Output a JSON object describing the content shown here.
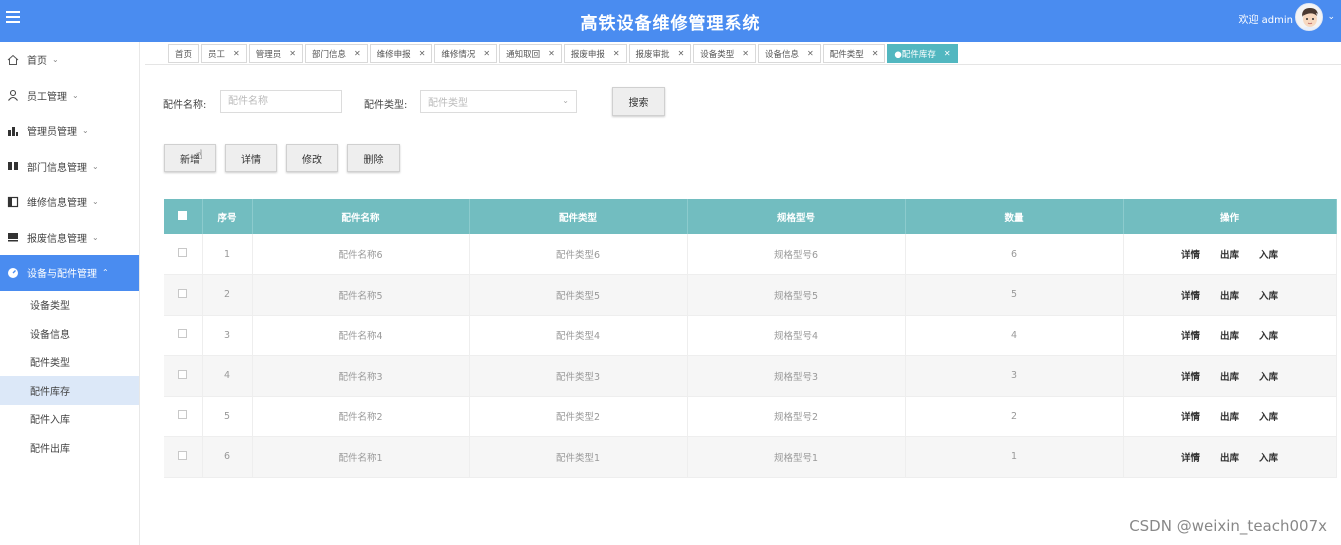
{
  "header": {
    "title": "高铁设备维修管理系统",
    "welcome": "欢迎 admin"
  },
  "sidebar": {
    "items": [
      {
        "label": "首页"
      },
      {
        "label": "员工管理"
      },
      {
        "label": "管理员管理"
      },
      {
        "label": "部门信息管理"
      },
      {
        "label": "维修信息管理"
      },
      {
        "label": "报废信息管理"
      },
      {
        "label": "设备与配件管理"
      }
    ],
    "subitems": [
      {
        "label": "设备类型"
      },
      {
        "label": "设备信息"
      },
      {
        "label": "配件类型"
      },
      {
        "label": "配件库存"
      },
      {
        "label": "配件入库"
      },
      {
        "label": "配件出库"
      }
    ]
  },
  "tabs": [
    {
      "label": "首页"
    },
    {
      "label": "员工"
    },
    {
      "label": "管理员"
    },
    {
      "label": "部门信息"
    },
    {
      "label": "维修申报"
    },
    {
      "label": "维修情况"
    },
    {
      "label": "通知取回"
    },
    {
      "label": "报废申报"
    },
    {
      "label": "报废审批"
    },
    {
      "label": "设备类型"
    },
    {
      "label": "设备信息"
    },
    {
      "label": "配件类型"
    },
    {
      "label": "●配件库存"
    }
  ],
  "search": {
    "name_label": "配件名称:",
    "name_placeholder": "配件名称",
    "type_label": "配件类型:",
    "type_placeholder": "配件类型",
    "search_button": "搜索"
  },
  "toolbar": {
    "add": "新增",
    "detail": "详情",
    "edit": "修改",
    "delete": "删除"
  },
  "table": {
    "headers": [
      "序号",
      "配件名称",
      "配件类型",
      "规格型号",
      "数量",
      "操作"
    ],
    "action_labels": {
      "detail": "详情",
      "out": "出库",
      "in": "入库"
    },
    "rows": [
      {
        "no": "1",
        "name": "配件名称6",
        "type": "配件类型6",
        "model": "规格型号6",
        "qty": "6"
      },
      {
        "no": "2",
        "name": "配件名称5",
        "type": "配件类型5",
        "model": "规格型号5",
        "qty": "5"
      },
      {
        "no": "3",
        "name": "配件名称4",
        "type": "配件类型4",
        "model": "规格型号4",
        "qty": "4"
      },
      {
        "no": "4",
        "name": "配件名称3",
        "type": "配件类型3",
        "model": "规格型号3",
        "qty": "3"
      },
      {
        "no": "5",
        "name": "配件名称2",
        "type": "配件类型2",
        "model": "规格型号2",
        "qty": "2"
      },
      {
        "no": "6",
        "name": "配件名称1",
        "type": "配件类型1",
        "model": "规格型号1",
        "qty": "1"
      }
    ]
  },
  "watermark": "CSDN @weixin_teach007x",
  "colors": {
    "header_bg": "#4a8cf0",
    "active_menu": "#4a8cf0",
    "table_header": "#72bdc0",
    "active_tab": "#52b7c0"
  }
}
